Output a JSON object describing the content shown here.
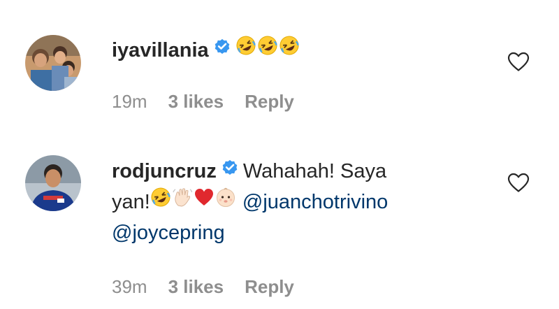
{
  "comments": [
    {
      "username": "iyavillania",
      "verified": true,
      "text": "",
      "emojis": [
        "rolling-on-floor-laughing",
        "rolling-on-floor-laughing",
        "rolling-on-floor-laughing"
      ],
      "time": "19m",
      "likes": "3 likes",
      "reply": "Reply"
    },
    {
      "username": "rodjuncruz",
      "verified": true,
      "text_part1": "Wahahah! Saya",
      "text_part2": "yan!",
      "emojis": [
        "rolling-on-floor-laughing",
        "waving-hand-light-skin",
        "red-heart",
        "baby-light-skin"
      ],
      "mention1": "@juanchotrivino",
      "mention2": "@joycepring",
      "time": "39m",
      "likes": "3 likes",
      "reply": "Reply"
    }
  ],
  "colors": {
    "text": "#262626",
    "secondary": "#8e8e8e",
    "mention": "#00376b",
    "verified_badge": "#3897f0"
  }
}
